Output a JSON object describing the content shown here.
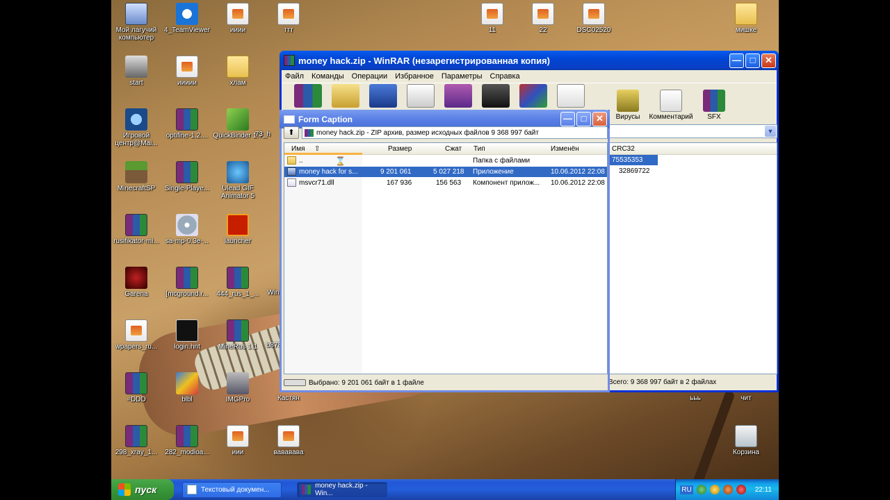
{
  "desktop": {
    "icons": [
      {
        "label": "Мой лагучий компьютер",
        "icon": "my-computer-icon"
      },
      {
        "label": "4_TeamViewer",
        "icon": "teamviewer-icon"
      },
      {
        "label": "ииии",
        "icon": "document-icon"
      },
      {
        "label": "ттт",
        "icon": "document-icon"
      },
      {
        "label": "11",
        "icon": "document-icon"
      },
      {
        "label": "22",
        "icon": "document-icon"
      },
      {
        "label": "DSC02520",
        "icon": "document-icon"
      },
      {
        "label": "мишке",
        "icon": "folder-icon"
      },
      {
        "label": "start",
        "icon": "counter-strike-shortcut-icon"
      },
      {
        "label": "иииии",
        "icon": "document-icon"
      },
      {
        "label": "хлам",
        "icon": "folder-icon"
      },
      {
        "label": "Игровой центр@Mai...",
        "icon": "game-center-icon"
      },
      {
        "label": "optifine-1.2....",
        "icon": "winrar-archive-icon"
      },
      {
        "label": "QuickBinder 1.7",
        "icon": "quickbinder-icon"
      },
      {
        "label": "73_h",
        "icon": "partial-icon"
      },
      {
        "label": "MinecraftSP",
        "icon": "minecraft-icon"
      },
      {
        "label": "Single-Playe...",
        "icon": "winrar-archive-icon"
      },
      {
        "label": "Ulead GIF Animator 5",
        "icon": "ulead-icon"
      },
      {
        "label": "rusifikator-mi...",
        "icon": "winrar-archive-icon"
      },
      {
        "label": "sa-mp-0.3e-...",
        "icon": "installer-cd-icon"
      },
      {
        "label": "launcher",
        "icon": "launcher-icon"
      },
      {
        "label": "Garena",
        "icon": "garena-icon"
      },
      {
        "label": "[mcground.r...",
        "icon": "winrar-archive-icon"
      },
      {
        "label": "444_rus_1_...",
        "icon": "winrar-archive-icon"
      },
      {
        "label": "Win",
        "icon": "partial-icon"
      },
      {
        "label": "wpapers_ru...",
        "icon": "document-icon"
      },
      {
        "label": "login.hnt",
        "icon": "hnt-icon"
      },
      {
        "label": "MineRus 1.1",
        "icon": "winrar-archive-icon"
      },
      {
        "label": "b878",
        "icon": "partial-icon"
      },
      {
        "label": "=DDD",
        "icon": "winrar-archive-icon"
      },
      {
        "label": "blbl",
        "icon": "image-icon"
      },
      {
        "label": "IMGPro",
        "icon": "imgpro-icon"
      },
      {
        "label": "Кастян",
        "icon": "none"
      },
      {
        "label": "ььь",
        "icon": "none"
      },
      {
        "label": "чит",
        "icon": "none"
      },
      {
        "label": "298_xray_1...",
        "icon": "winrar-archive-icon"
      },
      {
        "label": "282_modloa...",
        "icon": "winrar-archive-icon"
      },
      {
        "label": "иии",
        "icon": "document-icon"
      },
      {
        "label": "вававава",
        "icon": "document-icon"
      },
      {
        "label": "Корзина",
        "icon": "recycle-bin-icon"
      }
    ]
  },
  "rar_window": {
    "title": "money hack.zip - WinRAR (незарегистрированная копия)",
    "menu": [
      "Файл",
      "Команды",
      "Операции",
      "Избранное",
      "Параметры",
      "Справка"
    ],
    "toolbar": [
      {
        "label": "Вирусы",
        "icon": "virus-scan-icon"
      },
      {
        "label": "Комментарий",
        "icon": "comment-icon"
      },
      {
        "label": "SFX",
        "icon": "sfx-icon"
      }
    ],
    "header_col": "CRC32",
    "crc_values": [
      "75535353",
      "32869722"
    ],
    "status_total": "Всего: 9 368 997 байт в 2 файлах"
  },
  "form_window": {
    "title": "Form Caption",
    "path": "money hack.zip - ZIP архив, размер исходных файлов 9 368 997 байт",
    "columns": [
      "Имя",
      "Размер",
      "Сжат",
      "Тип",
      "Изменён"
    ],
    "rows": [
      {
        "name": "..",
        "size": "",
        "packed": "",
        "type": "Папка с файлами",
        "modified": "",
        "icon": "folder-up-icon",
        "selected": false
      },
      {
        "name": "money hack for s...",
        "size": "9 201 061",
        "packed": "5 027 218",
        "type": "Приложение",
        "modified": "10.06.2012 22:08",
        "icon": "exe-icon",
        "selected": true
      },
      {
        "name": "msvcr71.dll",
        "size": "167 936",
        "packed": "156 563",
        "type": "Компонент прилож...",
        "modified": "10.06.2012 22:08",
        "icon": "dll-icon",
        "selected": false
      }
    ],
    "status_selected": "Выбрано: 9 201 061 байт в 1 файле"
  },
  "taskbar": {
    "start_label": "пуск",
    "tasks": [
      {
        "label": "Текстовый докумен...",
        "active": false
      },
      {
        "label": "money hack.zip - Win...",
        "active": true
      }
    ],
    "lang": "RU",
    "clock": "22:11"
  }
}
